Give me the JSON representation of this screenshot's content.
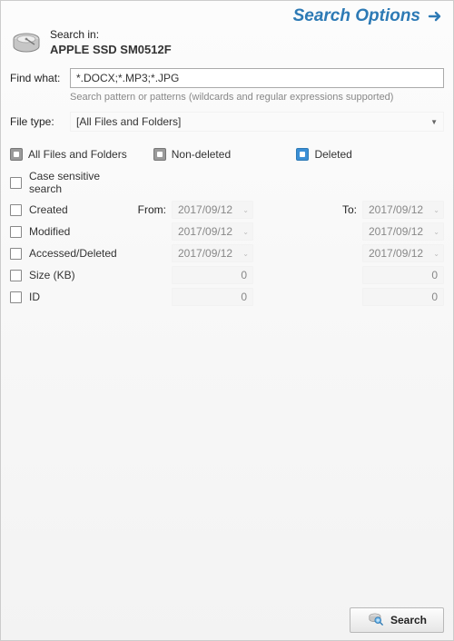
{
  "header": {
    "title": "Search Options"
  },
  "search_in": {
    "label": "Search in:",
    "drive_name": "APPLE SSD SM0512F"
  },
  "find_what": {
    "label": "Find what:",
    "value": "*.DOCX;*.MP3;*.JPG",
    "helper": "Search pattern or patterns (wildcards and regular expressions supported)"
  },
  "file_type": {
    "label": "File type:",
    "selected": "[All Files and Folders]"
  },
  "state_filters": {
    "all": "All Files and Folders",
    "non_deleted": "Non-deleted",
    "deleted": "Deleted"
  },
  "options": {
    "case_sensitive": "Case sensitive search",
    "created": "Created",
    "modified": "Modified",
    "accessed": "Accessed/Deleted",
    "size": "Size (KB)",
    "id": "ID",
    "from_label": "From:",
    "to_label": "To:",
    "date_value": "2017/09/12",
    "num_value": "0"
  },
  "footer": {
    "search_button": "Search"
  }
}
